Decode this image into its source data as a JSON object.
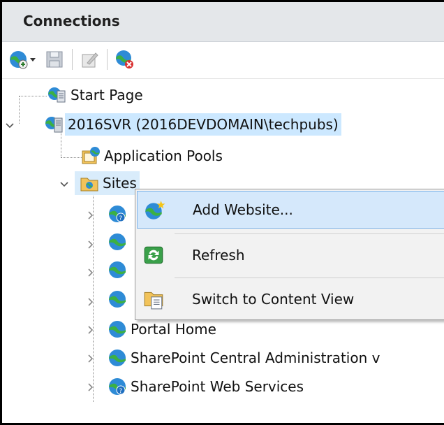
{
  "panel": {
    "title": "Connections"
  },
  "toolbar": {
    "buttons": [
      {
        "icon": "connect-globe-icon"
      },
      {
        "icon": "dropdown-arrow-icon"
      },
      {
        "icon": "save-icon"
      },
      {
        "icon": "edit-icon"
      },
      {
        "icon": "disconnect-icon"
      }
    ]
  },
  "tree": {
    "start_page": "Start Page",
    "server": "2016SVR (2016DEVDOMAIN\\techpubs)",
    "app_pools": "Application Pools",
    "sites": "Sites",
    "site_items": [
      "Portal Home",
      "SharePoint Central Administration v",
      "SharePoint Web Services"
    ]
  },
  "context_menu": {
    "items": [
      {
        "label": "Add Website...",
        "icon": "add-website-icon",
        "highlighted": true
      },
      {
        "label": "Refresh",
        "icon": "refresh-icon",
        "highlighted": false
      },
      {
        "label": "Switch to Content View",
        "icon": "content-view-icon",
        "highlighted": false
      }
    ]
  },
  "colors": {
    "selection": "#cce8ff",
    "header": "#e4e7ea",
    "menu_highlight": "#d5e8fb"
  }
}
